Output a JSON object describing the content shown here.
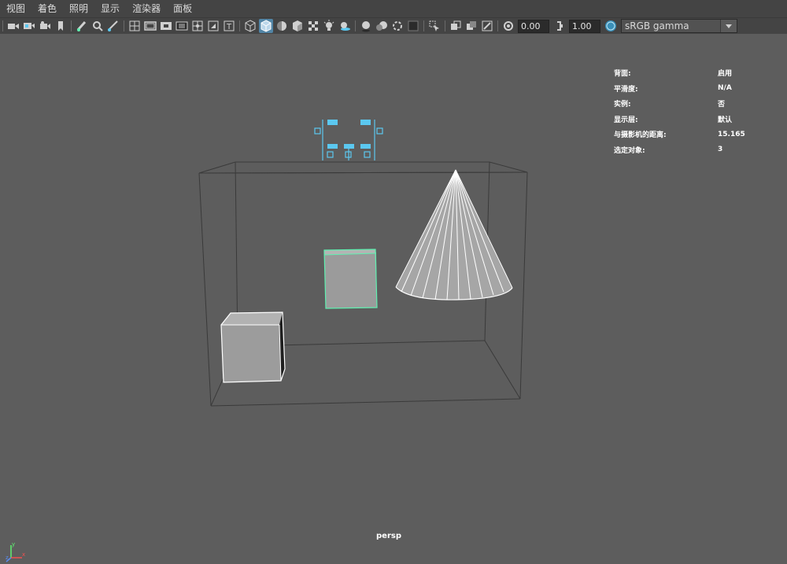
{
  "menu": {
    "items": [
      "视图",
      "着色",
      "照明",
      "显示",
      "渲染器",
      "面板"
    ]
  },
  "toolbar": {
    "icons": [
      "select-camera-icon",
      "camera-attributes-icon",
      "bookmark-camera-icon",
      "image-plane-icon",
      "grease-pencil-icon",
      "2d-pan-zoom-icon",
      "grid-icon",
      "film-gate-icon",
      "resolution-gate-icon",
      "gate-mask-icon",
      "field-chart-icon",
      "safe-action-icon",
      "safe-title-icon",
      "wireframe-icon",
      "smooth-shade-icon",
      "default-material-icon",
      "shaded-wireframe-icon",
      "textured-icon",
      "use-all-lights-icon",
      "shadows-icon",
      "screen-space-ao-icon",
      "motion-blur-icon",
      "multisample-aa-icon",
      "depth-of-field-icon",
      "isolate-select-icon",
      "xray-icon",
      "xray-joints-icon",
      "xray-components-icon",
      "exposure-icon",
      "gamma-icon",
      "colorspace-icon"
    ],
    "exposure_value": "0.00",
    "gamma_value": "1.00",
    "colorspace_label": "sRGB gamma",
    "active_color": "#5285a6"
  },
  "hud": {
    "rows": [
      {
        "label": "背面:",
        "value": "启用"
      },
      {
        "label": "平滑度:",
        "value": "N/A"
      },
      {
        "label": "实例:",
        "value": "否"
      },
      {
        "label": "显示层:",
        "value": "默认"
      },
      {
        "label": "与摄影机的距离:",
        "value": "15.165"
      },
      {
        "label": "选定对象:",
        "value": "3"
      }
    ]
  },
  "viewport": {
    "camera_label": "persp",
    "background_color": "#5d5d5d",
    "selection_color": "#5ff0b0",
    "manipulator_color": "#5bc8f0"
  },
  "axis": {
    "x": "x",
    "y": "y",
    "z": "z"
  }
}
